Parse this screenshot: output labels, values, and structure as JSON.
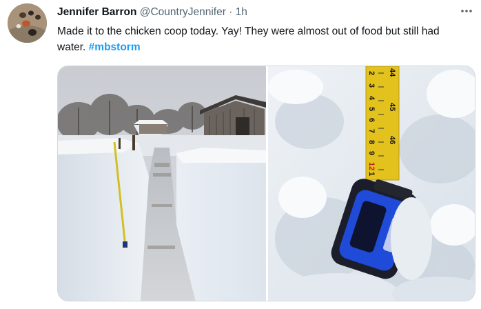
{
  "tweet": {
    "author_name": "Jennifer Barron",
    "author_handle": "@CountryJennifer",
    "separator": "·",
    "time": "1h",
    "text": "Made it to the chicken coop today. Yay!  They were almost out of food but still had water. ",
    "hashtag": "#mbstorm"
  },
  "icons": {
    "more": "more-horizontal-icon"
  },
  "tape_markings": {
    "left_column": [
      "44",
      "45",
      "46"
    ],
    "digits": [
      "2",
      "3",
      "4",
      "5",
      "6",
      "7",
      "8",
      "9",
      "12",
      "1",
      "2"
    ]
  },
  "colors": {
    "hashtag": "#1d9bf0",
    "secondary_text": "#536471",
    "border": "#cfd9de"
  }
}
